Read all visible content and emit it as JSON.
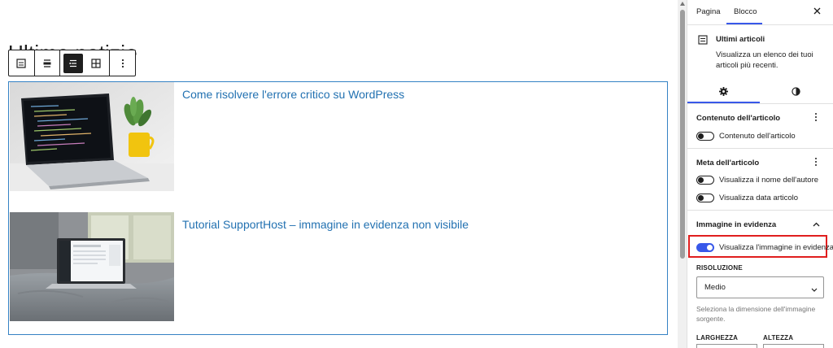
{
  "editor": {
    "heading": "Ultime notizie",
    "toolbar": {
      "icons": [
        "block-type-icon",
        "align-wide-icon",
        "list-view-icon",
        "grid-view-icon",
        "more-options-icon"
      ],
      "active": "list-view-icon"
    },
    "posts": [
      {
        "title": "Come risolvere l'errore critico su WordPress",
        "image": "laptop-code-photo"
      },
      {
        "title": "Tutorial SupportHost – immagine in evidenza non visibile",
        "image": "laptop-bed-photo"
      }
    ]
  },
  "sidebar": {
    "tabs": [
      {
        "label": "Pagina",
        "active": false
      },
      {
        "label": "Blocco",
        "active": true
      }
    ],
    "close_icon": "close-icon",
    "block": {
      "title": "Ultimi articoli",
      "description": "Visualizza un elenco dei tuoi articoli più recenti."
    },
    "sub_tabs": [
      "settings-gear-icon",
      "styles-contrast-icon"
    ],
    "panels": {
      "content": {
        "title": "Contenuto dell'articolo",
        "toggle_label": "Contenuto dell'articolo",
        "toggle_on": false
      },
      "meta": {
        "title": "Meta dell'articolo",
        "toggles": [
          {
            "label": "Visualizza il nome dell'autore",
            "on": false
          },
          {
            "label": "Visualizza data articolo",
            "on": false
          }
        ]
      },
      "featured_image": {
        "title": "Immagine in evidenza",
        "toggle_label": "Visualizza l'immagine in evidenza",
        "toggle_on": true,
        "resolution_label": "RISOLUZIONE",
        "resolution_value": "Medio",
        "resolution_help": "Seleziona la dimensione dell'immagine sorgente.",
        "width_label": "LARGHEZZA",
        "height_label": "ALTEZZA"
      }
    }
  },
  "colors": {
    "accent": "#3858e9",
    "link": "#2271b1",
    "block_border": "#3582c4",
    "highlight": "#e01e1e"
  }
}
